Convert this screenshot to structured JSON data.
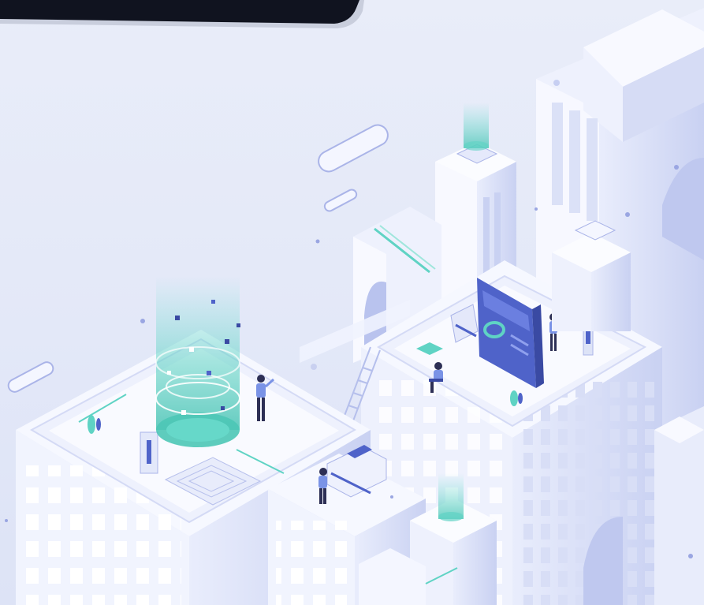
{
  "scene": {
    "palette": {
      "sky": "#e6ebf9",
      "building_light": "#f6f8ff",
      "building_mid": "#dde3f7",
      "building_shadow": "#b9c3ee",
      "window": "#ffffff",
      "accent_blue": "#4f63c9",
      "accent_dark": "#3a4aa3",
      "accent_teal": "#5fd3c4",
      "phone_frame": "#0f1220"
    },
    "icons": [
      "phone-frame-icon",
      "data-hologram-icon",
      "dashboard-screen-icon",
      "person-icon",
      "ladder-icon",
      "satellite-dish-icon"
    ]
  }
}
